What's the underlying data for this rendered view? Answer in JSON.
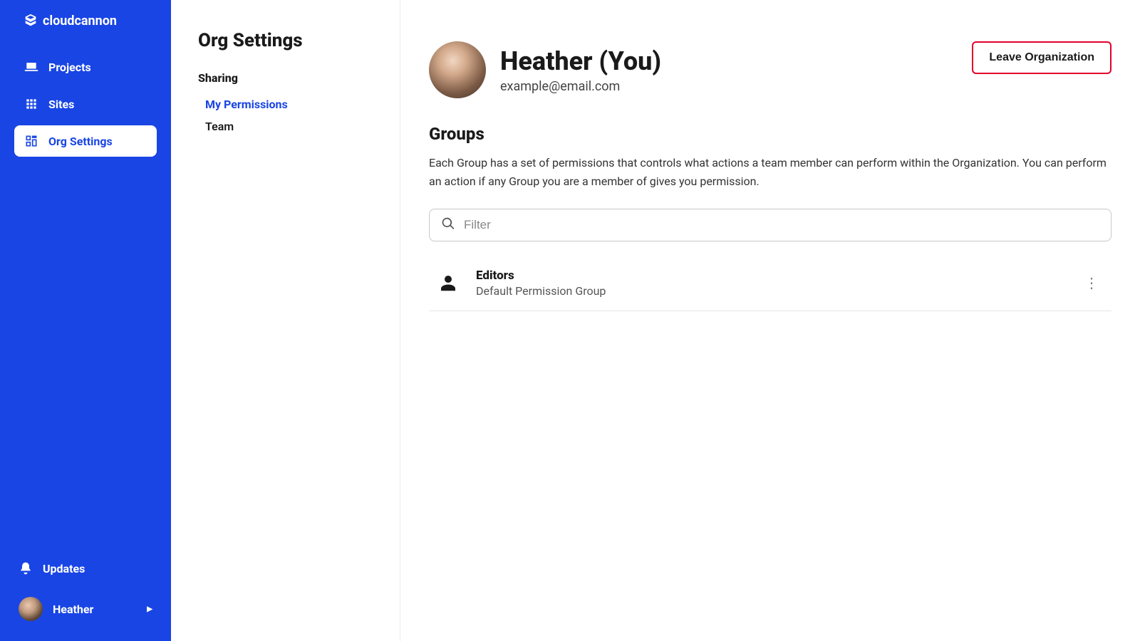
{
  "brand": {
    "name": "cloudcannon"
  },
  "sidebar": {
    "items": [
      {
        "label": "Projects"
      },
      {
        "label": "Sites"
      },
      {
        "label": "Org Settings"
      }
    ],
    "updates_label": "Updates",
    "user_name": "Heather"
  },
  "subnav": {
    "title": "Org Settings",
    "section": "Sharing",
    "items": [
      {
        "label": "My Permissions"
      },
      {
        "label": "Team"
      }
    ]
  },
  "profile": {
    "name": "Heather (You)",
    "email": "example@email.com",
    "leave_label": "Leave Organization"
  },
  "groups_section": {
    "title": "Groups",
    "description": "Each Group has a set of permissions that controls what actions a team member can perform within the Organization. You can perform an action if any Group you are a member of gives you permission.",
    "filter_placeholder": "Filter"
  },
  "groups": [
    {
      "name": "Editors",
      "subtitle": "Default Permission Group"
    }
  ]
}
